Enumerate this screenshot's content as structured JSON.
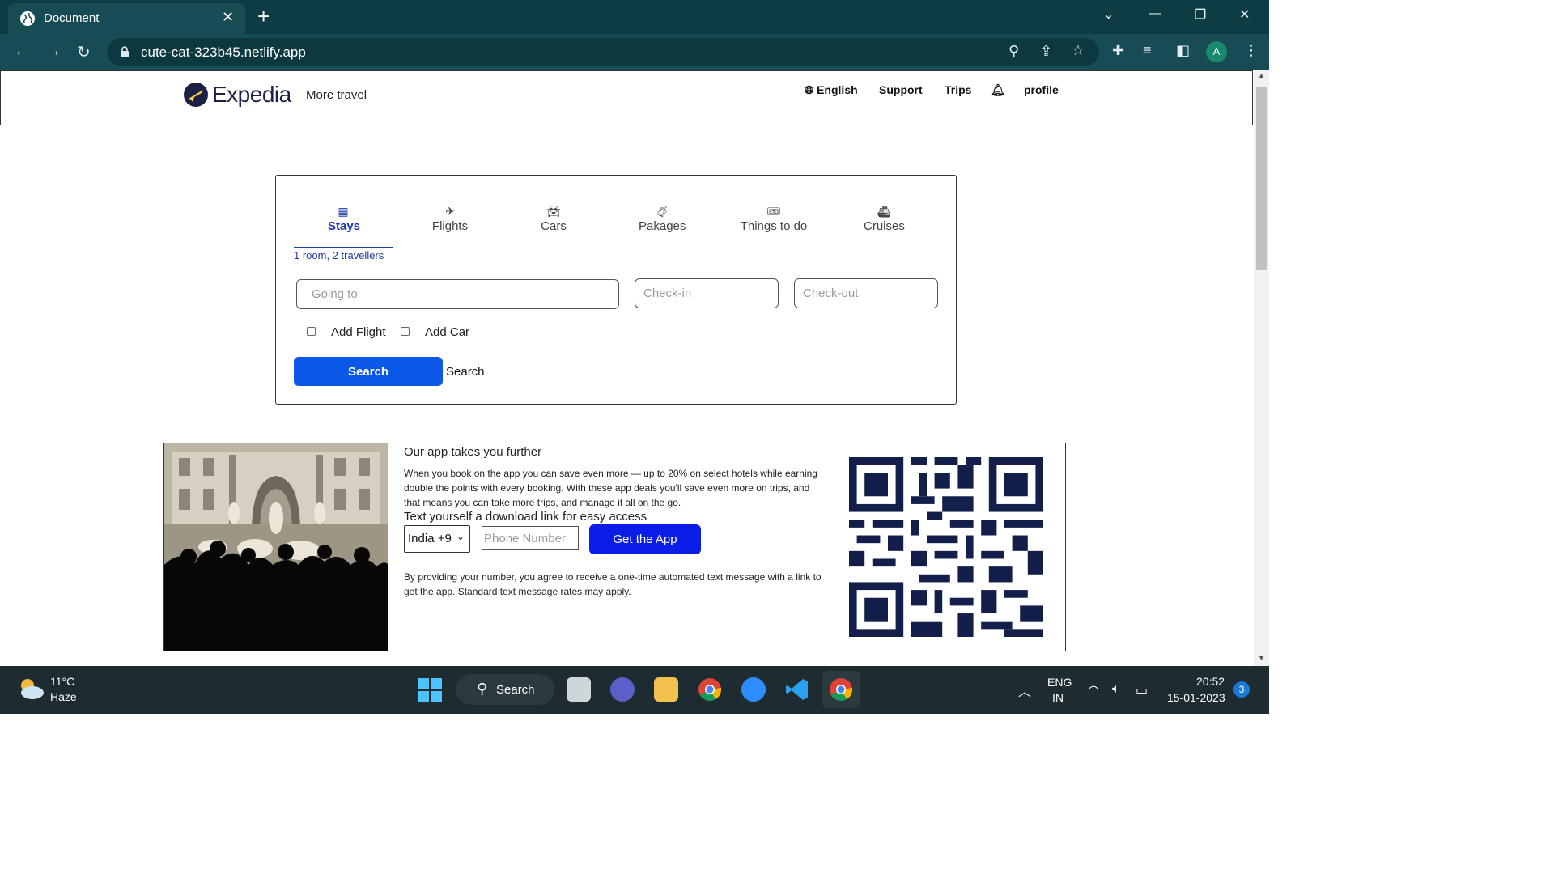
{
  "browser": {
    "tab_title": "Document",
    "url": "cute-cat-323b45.netlify.app",
    "avatar_letter": "A"
  },
  "site": {
    "brand": "Expedia",
    "tagline": "More travel",
    "nav": {
      "language": "English",
      "support": "Support",
      "trips": "Trips",
      "profile": "profile"
    }
  },
  "search": {
    "tabs": [
      {
        "label": "Stays",
        "active": true
      },
      {
        "label": "Flights",
        "active": false
      },
      {
        "label": "Cars",
        "active": false
      },
      {
        "label": "Pakages",
        "active": false
      },
      {
        "label": "Things to do",
        "active": false
      },
      {
        "label": "Cruises",
        "active": false
      }
    ],
    "rooms_label": "1 room, 2 travellers",
    "going_to_placeholder": "Going to",
    "checkin_placeholder": "Check-in",
    "checkout_placeholder": "Check-out",
    "add_flight_label": "Add Flight",
    "add_car_label": "Add Car",
    "search_button": "Search",
    "search_text": "Search"
  },
  "promo": {
    "title": "Our app takes you further",
    "description": "When you book on the app you can save even more — up to 20% on select hotels while earning double the points with every booking. With these app deals you'll save even more on trips, and that means you can take more trips, and manage it all on the go.",
    "text_link_label": "Text yourself a download link for easy access",
    "country_value": "India +9",
    "phone_placeholder": "Phone Number",
    "get_app_button": "Get the App",
    "legal": "By providing your number, you agree to receive a one-time automated text message with a link to get the app. Standard text message rates may apply."
  },
  "taskbar": {
    "weather_temp": "11°C",
    "weather_desc": "Haze",
    "search_label": "Search",
    "lang_primary": "ENG",
    "lang_secondary": "IN",
    "time": "20:52",
    "date": "15-01-2023",
    "notification_count": "3"
  }
}
